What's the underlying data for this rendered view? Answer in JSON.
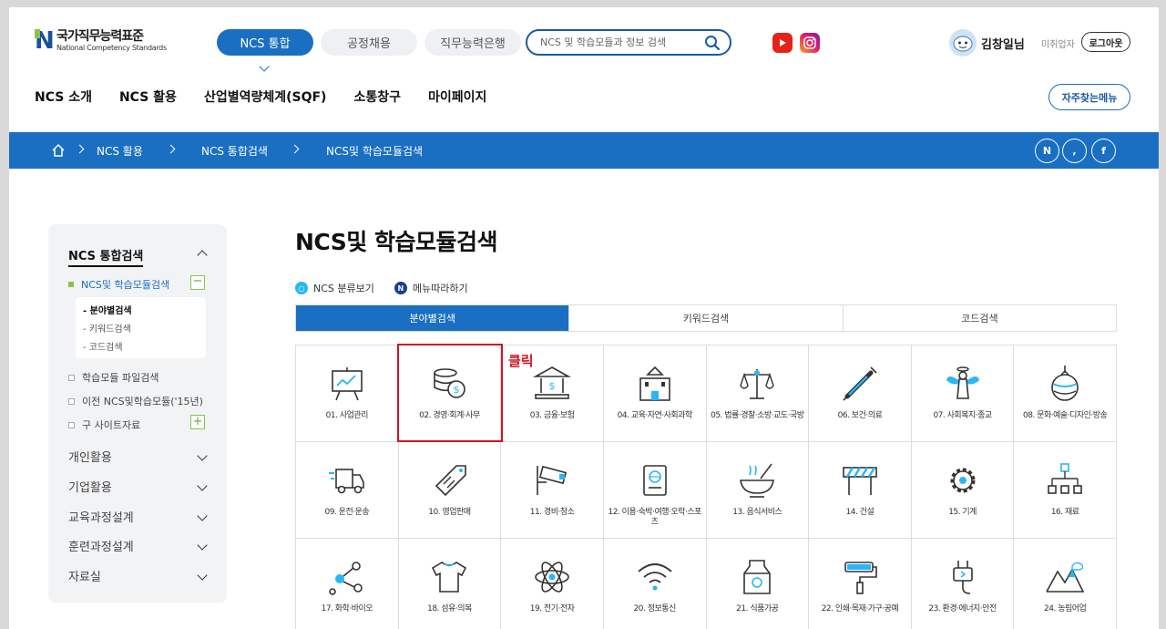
{
  "header": {
    "logo_kr": "국가직무능력표준",
    "logo_en": "National Competency Standards",
    "top_tabs": [
      "NCS 통합",
      "공정채용",
      "직무능력은행"
    ],
    "search_placeholder": "NCS 및 학습모듈과 정보 검색",
    "user_name": "김창일님",
    "withdraw": "미취업자",
    "logout": "로그아웃",
    "gnb": [
      "NCS 소개",
      "NCS 활용",
      "산업별역량체계(SQF)",
      "소통창구",
      "마이페이지"
    ],
    "frequent_menu": "자주찾는메뉴"
  },
  "breadcrumb": [
    "NCS 활용",
    "NCS 통합검색",
    "NCS및 학습모듈검색"
  ],
  "social": [
    "N",
    ",",
    "f"
  ],
  "sidebar": {
    "title": "NCS 통합검색",
    "sub_active": "NCS및 학습모듈검색",
    "sub_items": [
      "- 분야별검색",
      "- 키워드검색",
      "- 코드검색"
    ],
    "items": [
      "학습모듈 파일검색",
      "이전 NCS및학습모듈('15년)",
      "구 사이트자료"
    ],
    "groups": [
      "개인활용",
      "기업활용",
      "교육과정설계",
      "훈련과정설계",
      "자료실"
    ]
  },
  "main": {
    "title": "NCS및 학습모듈검색",
    "link1": "NCS 분류보기",
    "link2": "메뉴따라하기",
    "tabs": [
      "분야별검색",
      "키워드검색",
      "코드검색"
    ],
    "annotation": "클릭",
    "categories": [
      {
        "label": "01. 사업관리",
        "icon": "presentation-board-icon"
      },
      {
        "label": "02. 경영·회계·사무",
        "icon": "coins-dollar-icon"
      },
      {
        "label": "03. 금융·보험",
        "icon": "bank-icon"
      },
      {
        "label": "04. 교육·자연·사회과학",
        "icon": "school-building-icon"
      },
      {
        "label": "05. 법률·경찰·소방·교도·국방",
        "icon": "scales-icon"
      },
      {
        "label": "06. 보건·의료",
        "icon": "syringe-icon"
      },
      {
        "label": "07. 사회복지·종교",
        "icon": "angel-icon"
      },
      {
        "label": "08. 문화·예술·디자인·방송",
        "icon": "ornament-icon"
      },
      {
        "label": "09. 운전·운송",
        "icon": "truck-icon"
      },
      {
        "label": "10. 영업판매",
        "icon": "price-tag-icon"
      },
      {
        "label": "11. 경비·청소",
        "icon": "cctv-icon"
      },
      {
        "label": "12. 이용·숙박·여행·오락·스포츠",
        "icon": "passport-icon"
      },
      {
        "label": "13. 음식서비스",
        "icon": "bowl-icon"
      },
      {
        "label": "14. 건설",
        "icon": "barrier-icon"
      },
      {
        "label": "15. 기계",
        "icon": "gear-icon"
      },
      {
        "label": "16. 재료",
        "icon": "hierarchy-icon"
      },
      {
        "label": "17. 화학·바이오",
        "icon": "molecule-icon"
      },
      {
        "label": "18. 섬유·의복",
        "icon": "tshirt-icon"
      },
      {
        "label": "19. 전기·전자",
        "icon": "atom-icon"
      },
      {
        "label": "20. 정보통신",
        "icon": "wifi-icon"
      },
      {
        "label": "21. 식품가공",
        "icon": "milk-carton-icon"
      },
      {
        "label": "22. 인쇄·목재·가구·공예",
        "icon": "paint-roller-icon"
      },
      {
        "label": "23. 환경·에너지·안전",
        "icon": "plug-icon"
      },
      {
        "label": "24. 농림어업",
        "icon": "mountain-icon"
      }
    ]
  },
  "colors": {
    "primary": "#1a6fc2",
    "accent": "#29b6f6",
    "highlight": "#d0141f",
    "green": "#8bc34a"
  }
}
